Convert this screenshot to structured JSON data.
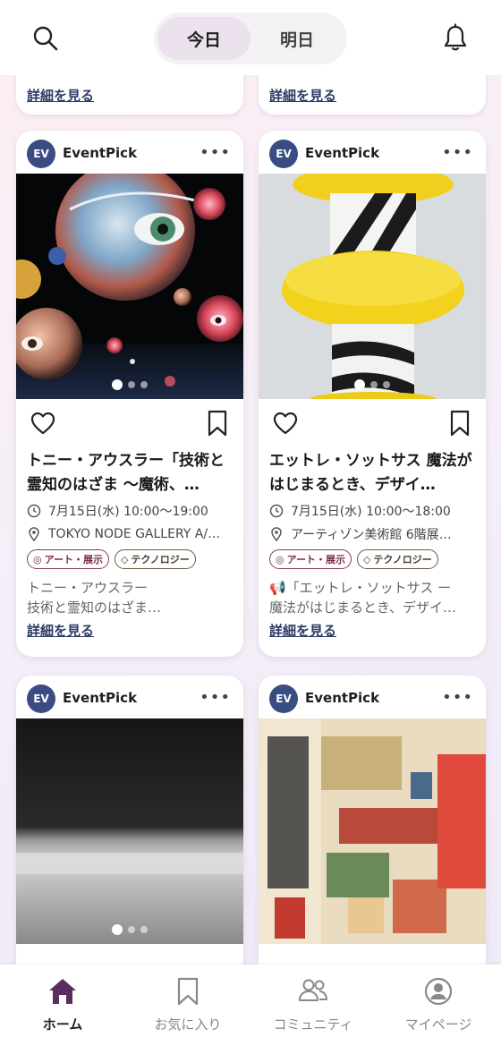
{
  "header": {
    "tabs": [
      {
        "label": "今日",
        "active": true
      },
      {
        "label": "明日",
        "active": false
      }
    ]
  },
  "top_cards": [
    {
      "more_label": "詳細を見る"
    },
    {
      "more_label": "詳細を見る"
    }
  ],
  "cards": [
    {
      "avatar": "EV",
      "account": "EventPick",
      "menu": "•••",
      "title": "トニー・アウスラー「技術と霊知のはざま 〜魔術、…",
      "date": "7月15日(水) 10:00〜19:00",
      "venue": "TOKYO NODE GALLERY A/…",
      "tags": [
        "アート・展示",
        "テクノロジー"
      ],
      "description": "トニー・アウスラー\n技術と霊知のはざま…",
      "more_label": "詳細を見る",
      "image_icon": "eyeball-spheres-art-image"
    },
    {
      "avatar": "EV",
      "account": "EventPick",
      "menu": "•••",
      "title": "エットレ・ソットサス 魔法がはじまるとき、デザイ…",
      "date": "7月15日(水) 10:00〜18:00",
      "venue": "アーティゾン美術館 6階展…",
      "tags": [
        "アート・展示",
        "テクノロジー"
      ],
      "description": "📢「エットレ・ソットサス ー\n魔法がはじまるとき、デザイ…",
      "more_label": "詳細を見る",
      "image_icon": "yellow-striped-sculpture-image"
    },
    {
      "avatar": "EV",
      "account": "EventPick",
      "menu": "•••",
      "image_icon": "monochrome-photo-image"
    },
    {
      "avatar": "EV",
      "account": "EventPick",
      "menu": "•••",
      "image_icon": "ukiyoe-poster-image"
    }
  ],
  "tabbar": [
    {
      "label": "ホーム",
      "icon": "home-icon",
      "active": true
    },
    {
      "label": "お気に入り",
      "icon": "bookmark-icon",
      "active": false
    },
    {
      "label": "コミュニティ",
      "icon": "people-icon",
      "active": false
    },
    {
      "label": "マイページ",
      "icon": "user-icon",
      "active": false
    }
  ],
  "colors": {
    "accent": "#5a2d5e",
    "tag_border": "#8a3b55",
    "link": "#2c3a66",
    "avatar_bg": "#3a4d82"
  }
}
